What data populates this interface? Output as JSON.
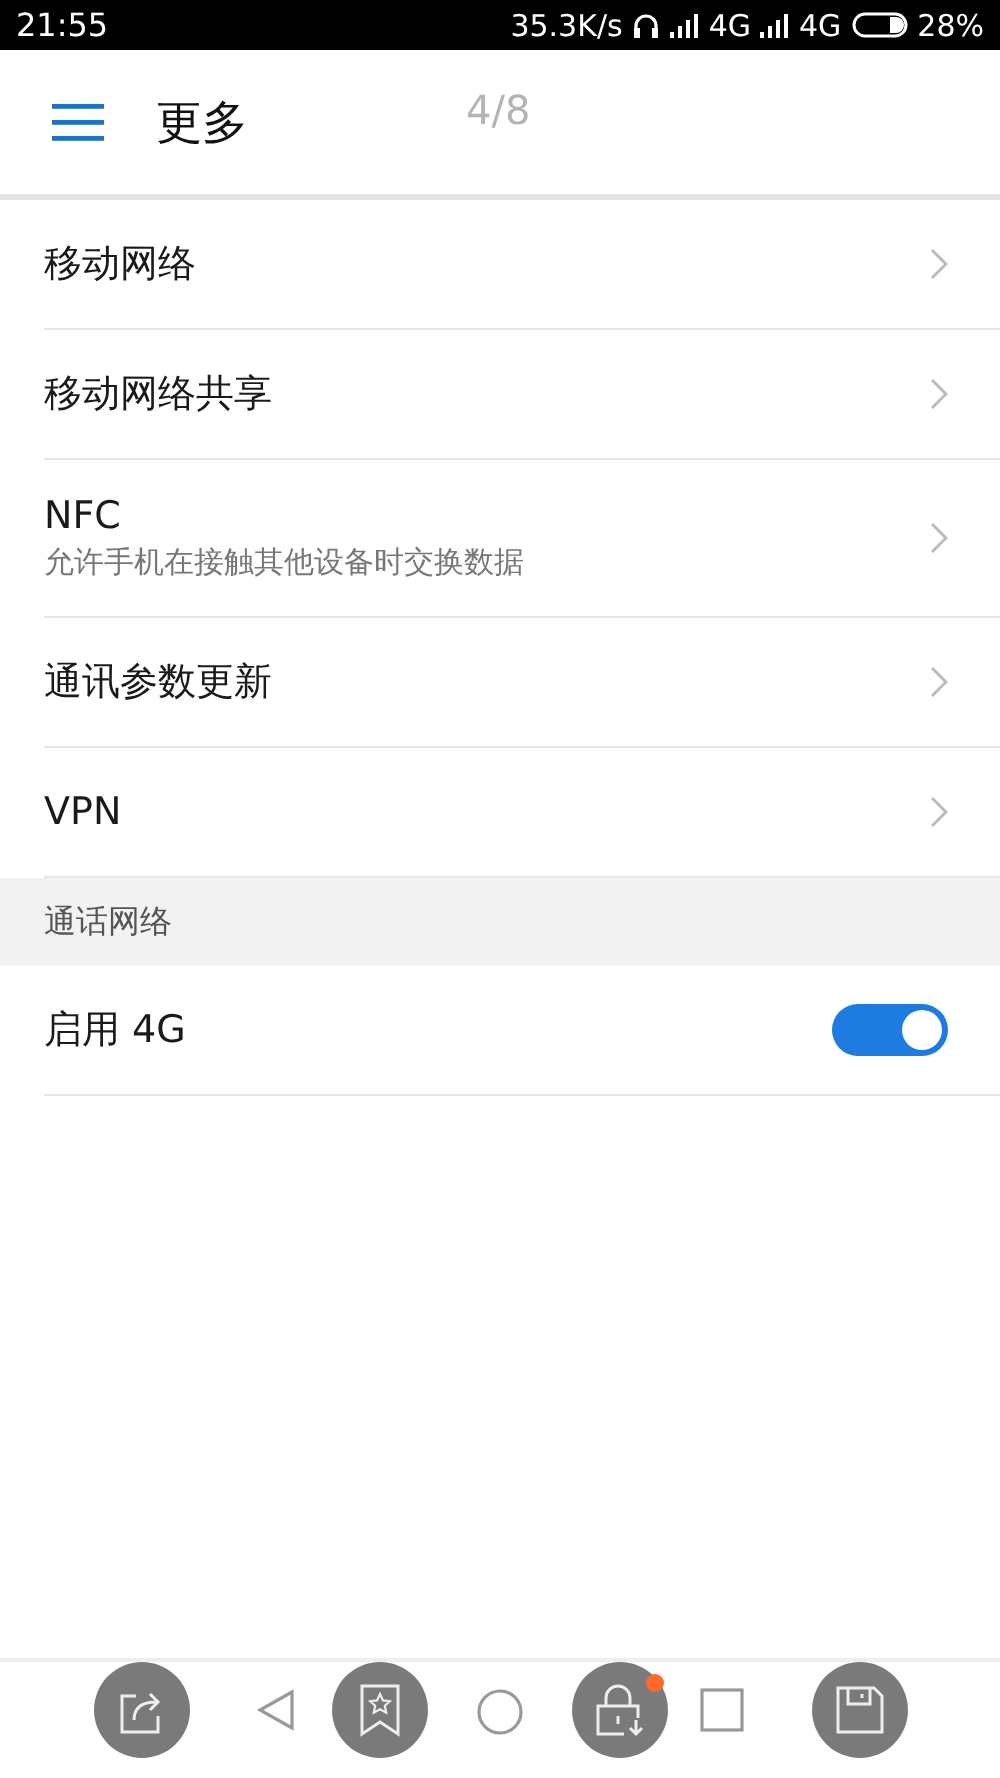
{
  "status_bar": {
    "time": "21:55",
    "speed": "35.3K/s",
    "network_1": "4G",
    "network_2": "4G",
    "battery": "28%"
  },
  "header": {
    "title": "更多",
    "page_indicator": "4/8"
  },
  "sections": [
    {
      "items": [
        {
          "kind": "link",
          "label": "移动网络"
        },
        {
          "kind": "link",
          "label": "移动网络共享"
        },
        {
          "kind": "link",
          "label": "NFC",
          "subtitle": "允许手机在接触其他设备时交换数据"
        },
        {
          "kind": "link",
          "label": "通讯参数更新"
        },
        {
          "kind": "link",
          "label": "VPN"
        }
      ]
    },
    {
      "title": "通话网络",
      "items": [
        {
          "kind": "switch",
          "label": "启用 4G",
          "on": true
        }
      ]
    }
  ],
  "overlay_buttons": [
    {
      "kind": "share",
      "badge": false
    },
    {
      "kind": "bookmark",
      "badge": false
    },
    {
      "kind": "unlock",
      "badge": true
    },
    {
      "kind": "save",
      "badge": false
    }
  ]
}
